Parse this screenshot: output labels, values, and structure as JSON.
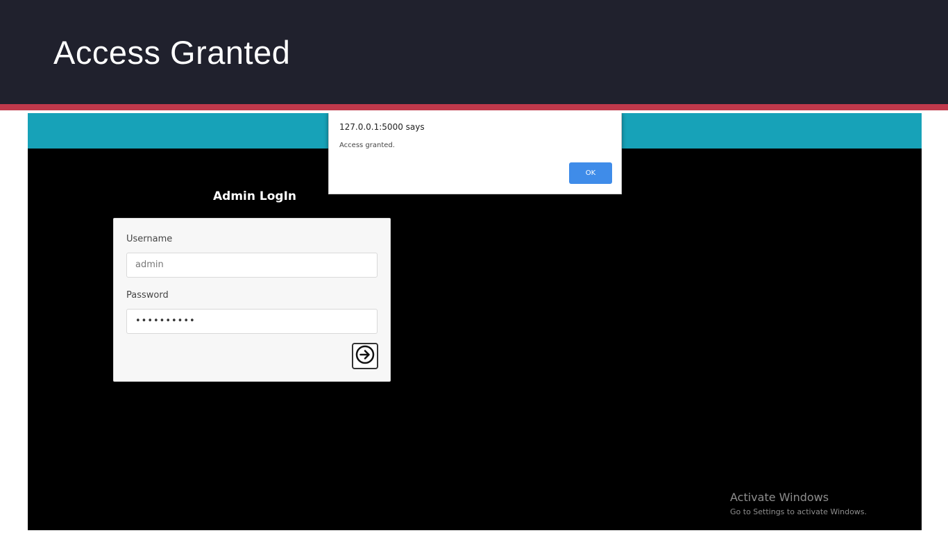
{
  "slide": {
    "title": "Access Granted",
    "colors": {
      "header_bg": "#20212d",
      "accent": "#c0394b"
    }
  },
  "app": {
    "navbar_color": "#17a2b8",
    "login": {
      "heading": "Admin LogIn",
      "username_label": "Username",
      "username_value": "admin",
      "password_label": "Password",
      "password_value": "••••••••••",
      "submit_icon": "arrow-right-circle-icon"
    }
  },
  "alert": {
    "origin": "127.0.0.1:5000 says",
    "message": "Access granted.",
    "ok_label": "OK",
    "ok_color": "#3f8ce9"
  },
  "watermark": {
    "title": "Activate Windows",
    "subtitle": "Go to Settings to activate Windows."
  }
}
